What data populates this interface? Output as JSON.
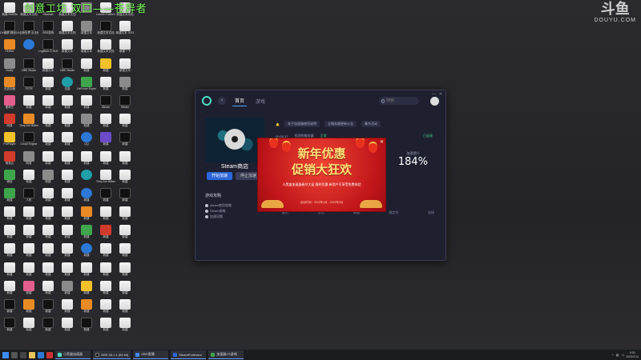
{
  "overlay_title": "创意工坊 双口——苍异者",
  "watermark": {
    "big": "斗鱼",
    "small": "DOUYU.COM"
  },
  "desktop_icons": [
    {
      "label": "新建 Dreikfa",
      "kind": "doc"
    },
    {
      "label": "新建文本文档",
      "kind": "doc"
    },
    {
      "label": "Stardust",
      "kind": "dark"
    },
    {
      "label": "新建文本文档",
      "kind": "doc"
    },
    {
      "label": "",
      "kind": "gray"
    },
    {
      "label": "Launch Editor.bat",
      "kind": "doc"
    },
    {
      "label": "新建文本文档",
      "kind": "doc"
    },
    {
      "label": "",
      "kind": "empty"
    },
    {
      "label": "DX截屏 精品2021",
      "kind": "dark"
    },
    {
      "label": "全新世界 点击即玩",
      "kind": "dark"
    },
    {
      "label": "OBS游戏",
      "kind": "dark"
    },
    {
      "label": "新建文本文档",
      "kind": "doc"
    },
    {
      "label": "新建文本",
      "kind": "gray"
    },
    {
      "label": "新建文本文档",
      "kind": "dark"
    },
    {
      "label": "新建文本 2021",
      "kind": "doc"
    },
    {
      "label": "",
      "kind": "empty"
    },
    {
      "label": "Firefox",
      "kind": "orange"
    },
    {
      "label": "",
      "kind": "blue"
    },
    {
      "label": "Logitech G HUB",
      "kind": "dark"
    },
    {
      "label": "新建文本",
      "kind": "doc"
    },
    {
      "label": "新建文本",
      "kind": "doc"
    },
    {
      "label": "新建文本文档",
      "kind": "doc"
    },
    {
      "label": "新建一下",
      "kind": "doc"
    },
    {
      "label": "",
      "kind": "empty"
    },
    {
      "label": "Dolby",
      "kind": "gray"
    },
    {
      "label": "OBS Studio",
      "kind": "dark"
    },
    {
      "label": "新建文本",
      "kind": "doc"
    },
    {
      "label": "OBS Studio",
      "kind": "dark"
    },
    {
      "label": "新建",
      "kind": "doc"
    },
    {
      "label": "新建",
      "kind": "yellow"
    },
    {
      "label": "新建文本",
      "kind": "doc"
    },
    {
      "label": "",
      "kind": "empty"
    },
    {
      "label": "迅游加速",
      "kind": "orange"
    },
    {
      "label": "TETR",
      "kind": "dark"
    },
    {
      "label": "新建",
      "kind": "doc"
    },
    {
      "label": "迅游",
      "kind": "teal"
    },
    {
      "label": "GeForce Experience",
      "kind": "green"
    },
    {
      "label": "新建",
      "kind": "doc"
    },
    {
      "label": "新建",
      "kind": "gray"
    },
    {
      "label": "",
      "kind": "empty"
    },
    {
      "label": "爱奇艺",
      "kind": "pink"
    },
    {
      "label": "新建",
      "kind": "doc"
    },
    {
      "label": "新建",
      "kind": "doc"
    },
    {
      "label": "新建",
      "kind": "doc"
    },
    {
      "label": "新建",
      "kind": "doc"
    },
    {
      "label": "Steam",
      "kind": "dark"
    },
    {
      "label": "Steam",
      "kind": "dark"
    },
    {
      "label": "",
      "kind": "empty"
    },
    {
      "label": "网易",
      "kind": "red"
    },
    {
      "label": "They Are Billions",
      "kind": "orange"
    },
    {
      "label": "新建",
      "kind": "doc"
    },
    {
      "label": "新建",
      "kind": "doc"
    },
    {
      "label": "新建",
      "kind": "gray"
    },
    {
      "label": "新建",
      "kind": "doc"
    },
    {
      "label": "新建",
      "kind": "doc"
    },
    {
      "label": "",
      "kind": "empty"
    },
    {
      "label": "PotPlayer",
      "kind": "yellow"
    },
    {
      "label": "Cloud Engine",
      "kind": "dark"
    },
    {
      "label": "新建",
      "kind": "doc"
    },
    {
      "label": "新建",
      "kind": "doc"
    },
    {
      "label": "QQ",
      "kind": "blue"
    },
    {
      "label": "新建",
      "kind": "purple"
    },
    {
      "label": "新建",
      "kind": "dark"
    },
    {
      "label": "",
      "kind": "empty"
    },
    {
      "label": "网易云",
      "kind": "red"
    },
    {
      "label": "网易",
      "kind": "gray"
    },
    {
      "label": "新建",
      "kind": "doc"
    },
    {
      "label": "新建",
      "kind": "doc"
    },
    {
      "label": "新建",
      "kind": "doc"
    },
    {
      "label": "新建",
      "kind": "doc"
    },
    {
      "label": "新建",
      "kind": "doc"
    },
    {
      "label": "",
      "kind": "empty"
    },
    {
      "label": "微信",
      "kind": "green"
    },
    {
      "label": "新建",
      "kind": "doc"
    },
    {
      "label": "新建",
      "kind": "gray"
    },
    {
      "label": "新建",
      "kind": "doc"
    },
    {
      "label": "",
      "kind": "teal"
    },
    {
      "label": "They Are Billions",
      "kind": "doc"
    },
    {
      "label": "新建",
      "kind": "doc"
    },
    {
      "label": "",
      "kind": "empty"
    },
    {
      "label": "新建",
      "kind": "green"
    },
    {
      "label": "人形",
      "kind": "dark"
    },
    {
      "label": "新建",
      "kind": "doc"
    },
    {
      "label": "新建",
      "kind": "doc"
    },
    {
      "label": "新建",
      "kind": "blue"
    },
    {
      "label": "新建",
      "kind": "dark"
    },
    {
      "label": "新建",
      "kind": "dark"
    },
    {
      "label": "",
      "kind": "empty"
    },
    {
      "label": "新建",
      "kind": "doc"
    },
    {
      "label": "新建",
      "kind": "doc"
    },
    {
      "label": "新建",
      "kind": "doc"
    },
    {
      "label": "新建",
      "kind": "doc"
    },
    {
      "label": "新建",
      "kind": "orange"
    },
    {
      "label": "新建",
      "kind": "doc"
    },
    {
      "label": "新建",
      "kind": "doc"
    },
    {
      "label": "",
      "kind": "empty"
    },
    {
      "label": "新建",
      "kind": "doc"
    },
    {
      "label": "新建",
      "kind": "doc"
    },
    {
      "label": "新建",
      "kind": "doc"
    },
    {
      "label": "新建",
      "kind": "doc"
    },
    {
      "label": "新建",
      "kind": "green"
    },
    {
      "label": "新建",
      "kind": "red"
    },
    {
      "label": "新建",
      "kind": "doc"
    },
    {
      "label": "",
      "kind": "empty"
    },
    {
      "label": "新建",
      "kind": "doc"
    },
    {
      "label": "新建",
      "kind": "doc"
    },
    {
      "label": "新建",
      "kind": "doc"
    },
    {
      "label": "新建",
      "kind": "doc"
    },
    {
      "label": "新建",
      "kind": "blue"
    },
    {
      "label": "新建",
      "kind": "doc"
    },
    {
      "label": "新建",
      "kind": "doc"
    },
    {
      "label": "",
      "kind": "empty"
    },
    {
      "label": "新建",
      "kind": "doc"
    },
    {
      "label": "新建",
      "kind": "doc"
    },
    {
      "label": "新建",
      "kind": "doc"
    },
    {
      "label": "新建",
      "kind": "doc"
    },
    {
      "label": "新建",
      "kind": "doc"
    },
    {
      "label": "新建",
      "kind": "doc"
    },
    {
      "label": "新建",
      "kind": "doc"
    },
    {
      "label": "",
      "kind": "empty"
    },
    {
      "label": "新建",
      "kind": "doc"
    },
    {
      "label": "新建",
      "kind": "pink"
    },
    {
      "label": "新建",
      "kind": "doc"
    },
    {
      "label": "新建",
      "kind": "gray"
    },
    {
      "label": "新建",
      "kind": "yellow"
    },
    {
      "label": "新建",
      "kind": "doc"
    },
    {
      "label": "新建",
      "kind": "doc"
    },
    {
      "label": "",
      "kind": "empty"
    },
    {
      "label": "新建",
      "kind": "dark"
    },
    {
      "label": "新建",
      "kind": "orange"
    },
    {
      "label": "新建",
      "kind": "dark"
    },
    {
      "label": "新建",
      "kind": "doc"
    },
    {
      "label": "新建",
      "kind": "orange"
    },
    {
      "label": "新建",
      "kind": "doc"
    },
    {
      "label": "新建",
      "kind": "doc"
    },
    {
      "label": "",
      "kind": "empty"
    },
    {
      "label": "新建",
      "kind": "dark"
    },
    {
      "label": "新建",
      "kind": "doc"
    },
    {
      "label": "新建",
      "kind": "dark"
    },
    {
      "label": "新建",
      "kind": "doc"
    },
    {
      "label": "新建",
      "kind": "dark"
    },
    {
      "label": "新建",
      "kind": "doc"
    },
    {
      "label": "新建",
      "kind": "doc"
    },
    {
      "label": "",
      "kind": "empty"
    }
  ],
  "app": {
    "nav_home": "首页",
    "nav_games": "游戏",
    "search_placeholder": "搜索",
    "game_title": "Steam商店",
    "accel_button": "开始加速",
    "secondary_button": "停止加速",
    "strategy_title": "游戏攻略",
    "strategy_items": [
      "steam使用攻略",
      "Steam攻略",
      "加速问题"
    ],
    "notices": [
      "关于加速器使用说明",
      "全服务器更新公告",
      "春节活动"
    ],
    "status_time": "00:00:37",
    "status_text": "检测到服务器",
    "status_ok": "正常",
    "status_right": "已连接",
    "metric_label": "加速提升",
    "metric_value": "184%",
    "chart_labels": [
      "延迟",
      "丢包",
      "网速",
      "稳定性",
      "连接"
    ]
  },
  "promo": {
    "line1": "新年优惠",
    "line2": "促销大狂欢",
    "description": "小黑盒加速器春节大促 限时优惠 新用户可享受免费体验",
    "date": "活动时间：2022年1月 - 2022年2月"
  },
  "taskbar": {
    "tasks": [
      "小黑盒加速器",
      "OBS 26.1.1 (64 bit)",
      "OBS直播",
      "SteamProfessor",
      "加速器CS游戏"
    ],
    "clock_time": "9:00",
    "clock_date": "2022/2/14"
  }
}
